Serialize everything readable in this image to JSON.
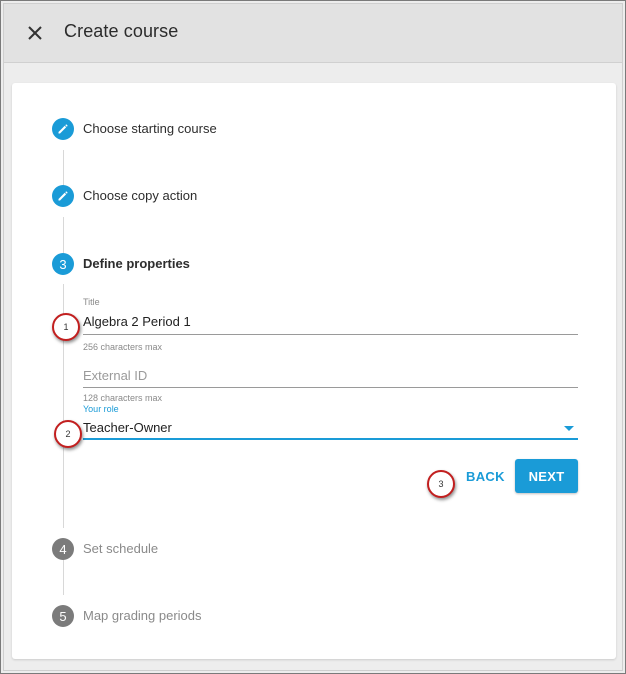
{
  "header": {
    "title": "Create course"
  },
  "steps": [
    {
      "marker": "",
      "label": "Choose starting course",
      "state": "completed"
    },
    {
      "marker": "",
      "label": "Choose copy action",
      "state": "completed"
    },
    {
      "marker": "3",
      "label": "Define properties",
      "state": "active"
    },
    {
      "marker": "4",
      "label": "Set schedule",
      "state": "inactive"
    },
    {
      "marker": "5",
      "label": "Map grading periods",
      "state": "inactive"
    }
  ],
  "form": {
    "title": {
      "label": "Title",
      "value": "Algebra 2 Period 1",
      "helper": "256 characters max"
    },
    "external_id": {
      "placeholder": "External ID",
      "helper": "128 characters max"
    },
    "role": {
      "label": "Your role",
      "value": "Teacher-Owner"
    }
  },
  "actions": {
    "back_label": "BACK",
    "next_label": "NEXT"
  },
  "callouts": [
    "1",
    "2",
    "3"
  ],
  "colors": {
    "accent": "#1a9bd7",
    "inactive_step": "#7b7b7b",
    "callout_border": "#c21f1f"
  },
  "icons": {
    "close": "close-icon",
    "completed_step": "pencil-icon",
    "dropdown": "caret-down-icon"
  }
}
